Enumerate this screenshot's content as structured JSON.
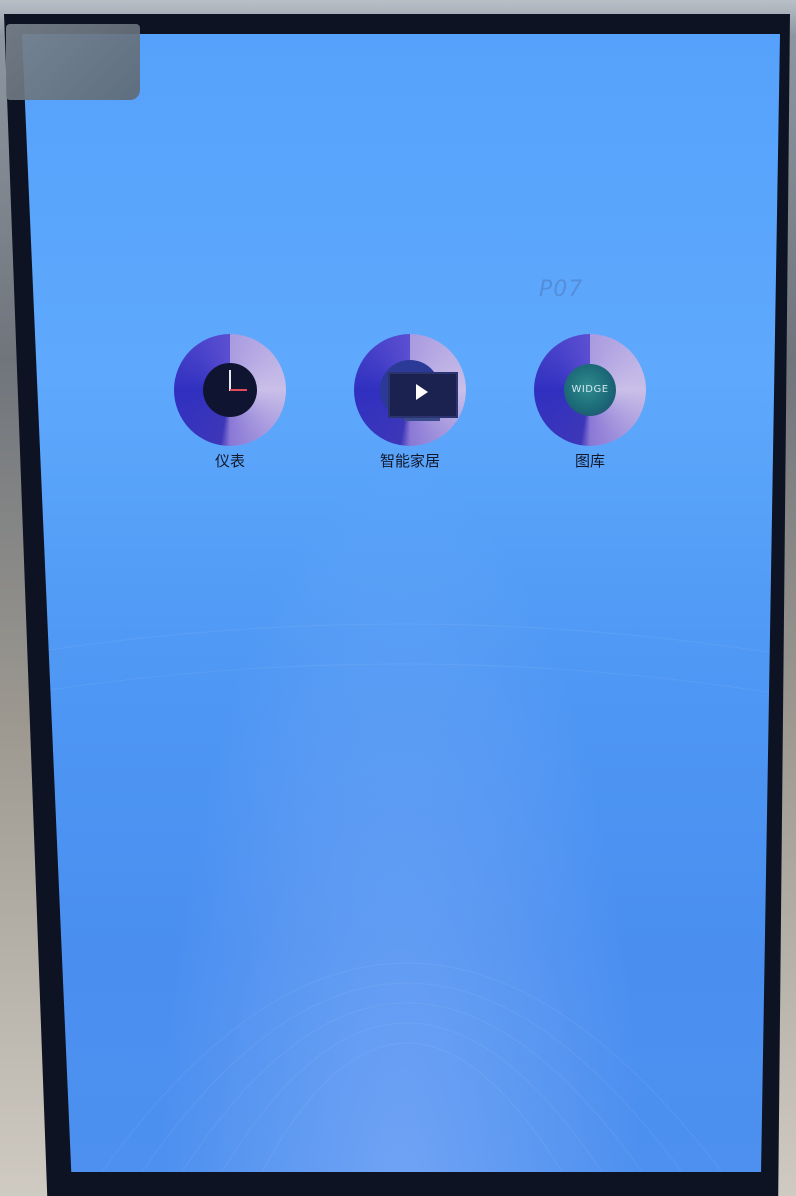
{
  "screen": {
    "watermark": "P07"
  },
  "apps": [
    {
      "label": "仪表",
      "icon": "clock-icon"
    },
    {
      "label": "智能家居",
      "icon": "tv-play-icon"
    },
    {
      "label": "图库",
      "icon": "gallery-icon",
      "icon_text": "WIDGE"
    }
  ],
  "colors": {
    "screen_blue": "#56a1fb",
    "ring_purple": "#a99be0",
    "ring_blue": "#3030c0",
    "bezel": "#0d1322"
  }
}
